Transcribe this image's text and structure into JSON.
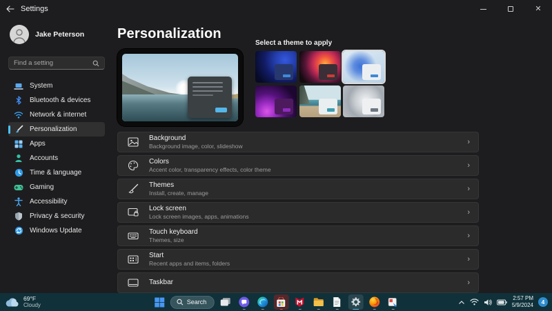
{
  "window": {
    "title": "Settings"
  },
  "user": {
    "name": "Jake Peterson"
  },
  "search": {
    "placeholder": "Find a setting"
  },
  "sidebar": {
    "items": [
      {
        "label": "System",
        "icon": "laptop-icon"
      },
      {
        "label": "Bluetooth & devices",
        "icon": "bluetooth-icon"
      },
      {
        "label": "Network & internet",
        "icon": "wifi-icon"
      },
      {
        "label": "Personalization",
        "icon": "brush-icon",
        "selected": true
      },
      {
        "label": "Apps",
        "icon": "apps-grid-icon"
      },
      {
        "label": "Accounts",
        "icon": "person-icon"
      },
      {
        "label": "Time & language",
        "icon": "clock-icon"
      },
      {
        "label": "Gaming",
        "icon": "gamepad-icon"
      },
      {
        "label": "Accessibility",
        "icon": "accessibility-icon"
      },
      {
        "label": "Privacy & security",
        "icon": "shield-icon"
      },
      {
        "label": "Windows Update",
        "icon": "update-icon"
      }
    ]
  },
  "main": {
    "title": "Personalization",
    "theme_label": "Select a theme to apply",
    "themes": [
      {
        "name": "theme-dark-blue-bloom",
        "accent": "#3f8cdb",
        "card": "#27386f"
      },
      {
        "name": "theme-dark-flower",
        "accent": "#cf3a34",
        "card": "#3a2f36"
      },
      {
        "name": "theme-light-blue-bloom",
        "accent": "#3f87d6",
        "card": "#eceff1",
        "selected": true
      },
      {
        "name": "theme-purple-glow",
        "accent": "#8d2bbf",
        "card": "#4d1a5e"
      },
      {
        "name": "theme-beach",
        "accent": "#3e9cae",
        "card": "#e9eef0"
      },
      {
        "name": "theme-gray-swirl",
        "accent": "#6d7780",
        "card": "#eef0f2"
      }
    ],
    "rows": [
      {
        "title": "Background",
        "subtitle": "Background image, color, slideshow",
        "icon": "picture-icon"
      },
      {
        "title": "Colors",
        "subtitle": "Accent color, transparency effects, color theme",
        "icon": "palette-icon"
      },
      {
        "title": "Themes",
        "subtitle": "Install, create, manage",
        "icon": "brush-icon"
      },
      {
        "title": "Lock screen",
        "subtitle": "Lock screen images, apps, animations",
        "icon": "lock-screen-icon"
      },
      {
        "title": "Touch keyboard",
        "subtitle": "Themes, size",
        "icon": "keyboard-icon"
      },
      {
        "title": "Start",
        "subtitle": "Recent apps and items, folders",
        "icon": "start-menu-icon"
      },
      {
        "title": "Taskbar",
        "icon": "taskbar-icon"
      }
    ]
  },
  "taskbar": {
    "weather": {
      "temp": "69°F",
      "condition": "Cloudy"
    },
    "search_label": "Search",
    "apps": [
      "start",
      "search",
      "task-view",
      "chat",
      "edge",
      "microsoft-store",
      "mcafee",
      "file-explorer",
      "notepad",
      "settings",
      "firefox",
      "remote-sketch-app"
    ],
    "tray": {
      "icons": [
        "chevron-up",
        "wifi",
        "volume",
        "battery"
      ],
      "time": "2:57 PM",
      "date": "5/9/2024",
      "badge": "4"
    }
  },
  "colors": {
    "accent": "#4cc2ff",
    "taskbar_bg": "#10313a",
    "card_bg": "#2b2b2b",
    "window_bg": "#1d1d1f"
  }
}
